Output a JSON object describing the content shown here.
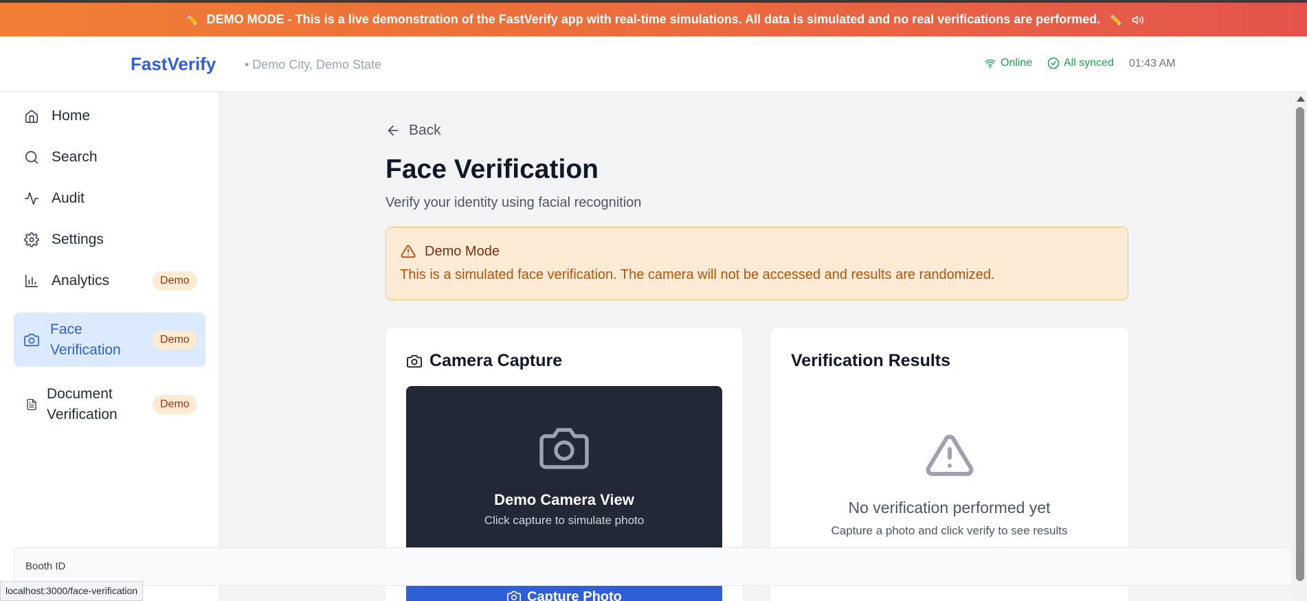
{
  "banner": {
    "pencil_left": "✏️",
    "prefix": "DEMO MODE - ",
    "message": "This is a live demonstration of the FastVerify app with real-time simulations. All data is simulated and no real verifications are performed.",
    "pencil_right": "✏️",
    "sound_icon": "speaker-icon"
  },
  "header": {
    "brand": "FastVerify",
    "location": "• Demo City, Demo State",
    "status_online": "Online",
    "status_sync": "All synced",
    "time": "01:43 AM",
    "online_color": "#16a34a"
  },
  "sidebar": {
    "items": [
      {
        "label": "Home",
        "icon": "home-icon"
      },
      {
        "label": "Search",
        "icon": "search-icon"
      },
      {
        "label": "Audit",
        "icon": "activity-icon"
      },
      {
        "label": "Settings",
        "icon": "gear-icon"
      },
      {
        "label": "Analytics",
        "icon": "bar-chart-icon",
        "badge": "Demo"
      },
      {
        "label": "Face Verification",
        "icon": "camera-icon",
        "badge": "Demo",
        "active": true
      },
      {
        "label": "Document Verification",
        "icon": "document-icon",
        "badge": "Demo"
      }
    ]
  },
  "main": {
    "back_label": "Back",
    "title": "Face Verification",
    "subtitle": "Verify your identity using facial recognition",
    "alert": {
      "title": "Demo Mode",
      "text": "This is a simulated face verification. The camera will not be accessed and results are randomized."
    },
    "camera_card": {
      "title": "Camera Capture",
      "view_title": "Demo Camera View",
      "view_subtitle": "Click capture to simulate photo",
      "capture_label": "Capture Photo"
    },
    "results_card": {
      "title": "Verification Results",
      "empty_title": "No verification performed yet",
      "empty_subtitle": "Capture a photo and click verify to see results"
    }
  },
  "footer": {
    "booth_label": "Booth ID"
  },
  "status_bar": {
    "url": "localhost:3000/face-verification"
  },
  "colors": {
    "accent": "#2f5fd6",
    "banner_start": "#f07e34",
    "banner_end": "#e4544d",
    "alert_bg": "#fdebd6",
    "camera_bg": "#222835"
  }
}
